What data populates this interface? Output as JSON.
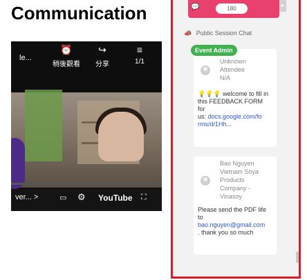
{
  "heading": "Communication",
  "video": {
    "title": "le...",
    "watch_later_label": "稍後觀看",
    "share_label": "分享",
    "counter": "1/1",
    "more_label": "ver...",
    "youtube_label": "YouTube"
  },
  "chat": {
    "count": "180",
    "session_title": "Public Session Chat",
    "messages": [
      {
        "badge": "Event Admin",
        "name_lines": [
          "Unknown",
          "Attendee",
          "N/A"
        ],
        "body_lines": [
          "💡💡💡 welcome to fill in",
          "this FEEDBACK FORM",
          "for",
          "us: docs.google.com/fo",
          "rms/d/1Hh..."
        ],
        "link_text": "docs.google.com/fo rms/d/1Hh..."
      },
      {
        "name_lines": [
          "Bao Nguyen",
          "Vietnam Soya",
          "Products",
          "Company -",
          "Vinasoy"
        ],
        "body_lines": [
          "Please send the PDF life",
          "to",
          "bao.nguyen@gmail.com",
          ". thank you so much"
        ],
        "email": "bao.nguyen@gmail.com"
      }
    ]
  },
  "icons": {
    "chat": "chat-icon",
    "megaphone": "megaphone-icon",
    "clock": "clock-icon",
    "share": "share-icon",
    "playlist": "playlist-icon",
    "captions": "captions-icon",
    "settings": "gear-icon",
    "fullscreen": "fullscreen-icon"
  },
  "colors": {
    "accent": "#e8416d",
    "frame": "#e11a21",
    "admin_badge": "#3fb24f",
    "link": "#2f56c6"
  }
}
